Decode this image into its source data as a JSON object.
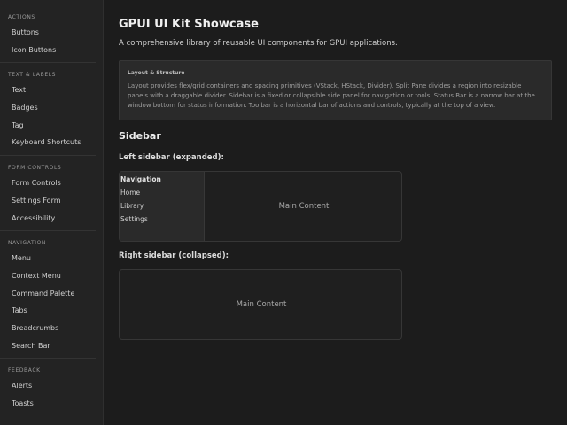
{
  "sidebar": {
    "sections": [
      {
        "header": "ACTIONS",
        "items": [
          "Buttons",
          "Icon Buttons"
        ]
      },
      {
        "header": "TEXT & LABELS",
        "items": [
          "Text",
          "Badges",
          "Tag",
          "Keyboard Shortcuts"
        ]
      },
      {
        "header": "FORM CONTROLS",
        "items": [
          "Form Controls",
          "Settings Form",
          "Accessibility"
        ]
      },
      {
        "header": "NAVIGATION",
        "items": [
          "Menu",
          "Context Menu",
          "Command Palette",
          "Tabs",
          "Breadcrumbs",
          "Search Bar"
        ]
      },
      {
        "header": "FEEDBACK",
        "items": [
          "Alerts",
          "Toasts"
        ]
      }
    ]
  },
  "main": {
    "title": "GPUI UI Kit Showcase",
    "subtitle": "A comprehensive library of reusable UI components for GPUI applications.",
    "info": {
      "title": "Layout & Structure",
      "text": "Layout provides flex/grid containers and spacing primitives (VStack, HStack, Divider). Split Pane divides a region into resizable panels with a draggable divider. Sidebar is a fixed or collapsible side panel for navigation or tools. Status Bar is a narrow bar at the window bottom for status information. Toolbar is a horizontal bar of actions and controls, typically at the top of a view."
    },
    "section_title": "Sidebar",
    "left_demo": {
      "label": "Left sidebar (expanded):",
      "nav_title": "Navigation",
      "nav_items": [
        "Home",
        "Library",
        "Settings"
      ],
      "main_text": "Main Content"
    },
    "right_demo": {
      "label": "Right sidebar (collapsed):",
      "main_text": "Main Content"
    }
  }
}
